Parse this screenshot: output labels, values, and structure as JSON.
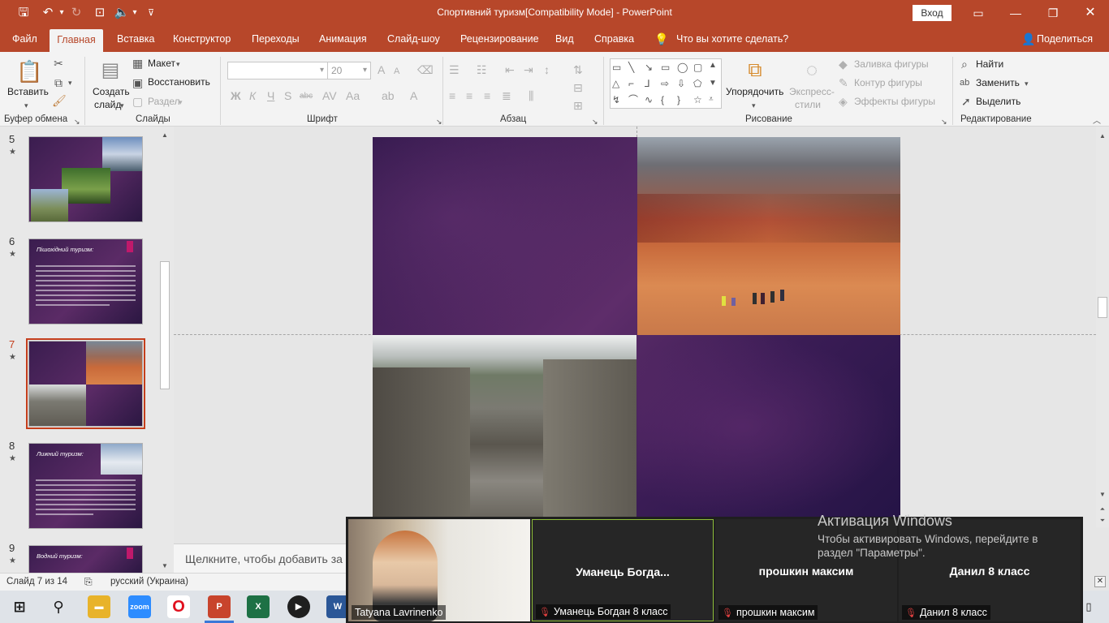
{
  "titlebar": {
    "title": "Спортивний туризм[Compatibility Mode]  -  PowerPoint",
    "signin": "Вход"
  },
  "tabs": [
    {
      "label": "Файл"
    },
    {
      "label": "Главная"
    },
    {
      "label": "Вставка"
    },
    {
      "label": "Конструктор"
    },
    {
      "label": "Переходы"
    },
    {
      "label": "Анимация"
    },
    {
      "label": "Слайд-шоу"
    },
    {
      "label": "Рецензирование"
    },
    {
      "label": "Вид"
    },
    {
      "label": "Справка"
    },
    {
      "label": "Что вы хотите сделать?"
    }
  ],
  "share": "Поделиться",
  "ribbon": {
    "clipboard": {
      "paste": "Вставить",
      "label": "Буфер обмена"
    },
    "slides": {
      "new_slide_line1": "Создать",
      "new_slide_line2": "слайд",
      "layout": "Макет",
      "reset": "Восстановить",
      "section": "Раздел",
      "label": "Слайды"
    },
    "font": {
      "size": "20",
      "label": "Шрифт"
    },
    "paragraph": {
      "label": "Абзац"
    },
    "drawing": {
      "arrange": "Упорядочить",
      "quick_styles_line1": "Экспресс-",
      "quick_styles_line2": "стили",
      "shape_fill": "Заливка фигуры",
      "shape_outline": "Контур фигуры",
      "shape_effects": "Эффекты фигуры",
      "label": "Рисование"
    },
    "editing": {
      "find": "Найти",
      "replace": "Заменить",
      "select": "Выделить",
      "label": "Редактирование"
    }
  },
  "slides": [
    {
      "num": "5",
      "title": ""
    },
    {
      "num": "6",
      "title": "Пішохідний туризм:"
    },
    {
      "num": "7",
      "title": ""
    },
    {
      "num": "8",
      "title": "Лижний туризм:"
    },
    {
      "num": "9",
      "title": "Водний туризм:"
    }
  ],
  "notes_placeholder": "Щелкните, чтобы добавить за",
  "status": {
    "slide": "Слайд 7 из 14",
    "language": "русский (Украина)"
  },
  "zoom": {
    "self_name": "Tatyana Lavrinenko",
    "tiles": [
      {
        "big": "Уманець  Богда...",
        "label": "Уманець Богдан 8 класс"
      },
      {
        "big": "прошкин максим",
        "label": "прошкин максим"
      },
      {
        "big": "Данил 8 класс",
        "label": "Данил 8 класс"
      }
    ]
  },
  "activation": {
    "title": "Активация Windows",
    "text_line1": "Чтобы активировать Windows, перейдите в",
    "text_line2": "раздел \"Параметры\"."
  },
  "taskbar": {
    "zoom": "zoom"
  },
  "colors": {
    "accent": "#b7472a",
    "slide_bg": "#4a2460"
  }
}
